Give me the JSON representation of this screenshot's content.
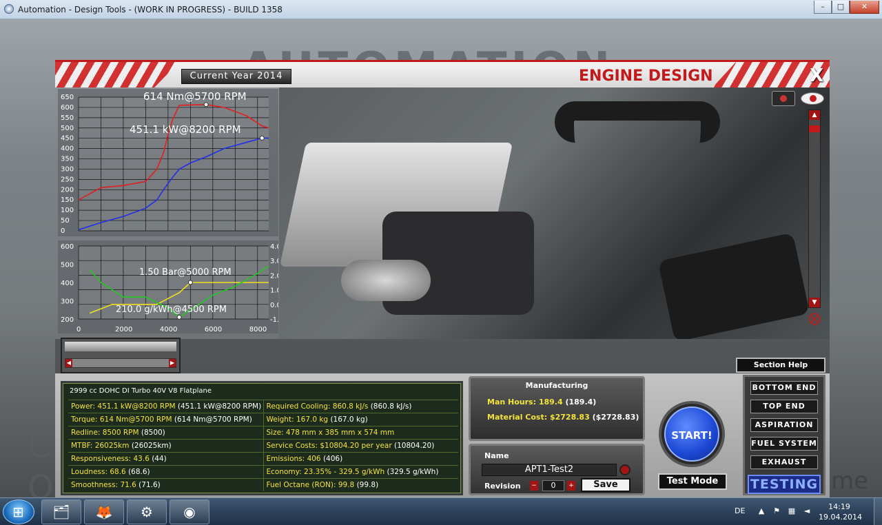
{
  "window": {
    "title": "Automation - Design Tools - (WORK IN PROGRESS) - BUILD 1358",
    "minimize": "–",
    "maximize": "□",
    "close": "✕"
  },
  "backdrop": {
    "left_text": "C\nO",
    "right_text": "me"
  },
  "header": {
    "year_label": "Current Year 2014",
    "title": "ENGINE DESIGN",
    "close_label": "X"
  },
  "graph_top": {
    "y_ticks": [
      "650",
      "600",
      "550",
      "500",
      "450",
      "400",
      "350",
      "300",
      "250",
      "200",
      "150",
      "100",
      "50",
      "0"
    ],
    "torque_label": "614 Nm@5700 RPM",
    "power_label": "451.1 kW@8200 RPM",
    "colors": {
      "torque": "#e02020",
      "power": "#1f2fe8"
    }
  },
  "graph_bottom": {
    "y_ticks_left": [
      "600",
      "500",
      "400",
      "300",
      "200"
    ],
    "y_ticks_right": [
      "4.0",
      "3.0",
      "2.0",
      "1.0",
      "0.0",
      "-1.0"
    ],
    "x_ticks": [
      "0",
      "2000",
      "4000",
      "6000",
      "8000"
    ],
    "boost_label": "1.50 Bar@5000 RPM",
    "bsfc_label": "210.0 g/kWh@4500 RPM",
    "colors": {
      "boost": "#f0e020",
      "bsfc": "#22c822"
    }
  },
  "chart_data": [
    {
      "type": "line",
      "title": "",
      "xlabel": "",
      "ylabel": "",
      "xlim": [
        0,
        8500
      ],
      "ylim": [
        0,
        650
      ],
      "series": [
        {
          "name": "",
          "x": [
            0,
            1000,
            2000,
            3000,
            3500,
            3800,
            4000,
            4200,
            4500,
            5000,
            5700,
            6500,
            7500,
            8200,
            8500
          ],
          "y": [
            150,
            210,
            220,
            240,
            300,
            380,
            470,
            540,
            610,
            612,
            614,
            600,
            560,
            510,
            500
          ]
        },
        {
          "name": "",
          "x": [
            0,
            1000,
            2000,
            3000,
            3500,
            3800,
            4200,
            4500,
            5000,
            5700,
            6500,
            7500,
            8200,
            8500
          ],
          "y": [
            5,
            40,
            70,
            110,
            150,
            200,
            260,
            300,
            330,
            360,
            400,
            430,
            451.1,
            451.1
          ]
        }
      ]
    },
    {
      "type": "line",
      "title": "",
      "xlabel": "",
      "ylabel": "",
      "xlim": [
        0,
        8500
      ],
      "ylim": [
        200,
        600
      ],
      "ylim_right": [
        -1.0,
        4.0
      ],
      "series": [
        {
          "name": "",
          "x": [
            500,
            1500,
            2500,
            3500,
            4000,
            4500,
            5000,
            6000,
            7000,
            8500
          ],
          "y": [
            -0.6,
            0.0,
            0.0,
            0.0,
            0.4,
            0.8,
            1.5,
            1.5,
            1.5,
            1.5
          ]
        },
        {
          "name": "",
          "x": [
            500,
            1000,
            2000,
            3000,
            4000,
            4500,
            5000,
            6000,
            7000,
            8000,
            8500
          ],
          "y": [
            470,
            400,
            320,
            320,
            260,
            210,
            250,
            330,
            380,
            450,
            490
          ]
        }
      ]
    }
  ],
  "stats": {
    "heading": "2999 cc DOHC DI Turbo 40V V8 Flatplane",
    "rows": [
      {
        "l_label": "Power: 451.1 kW@8200 RPM",
        "l_extra": " (451.1 kW@8200 RPM)",
        "r_label": "Required Cooling: 860.8 kJ/s",
        "r_extra": " (860.8 kJ/s)"
      },
      {
        "l_label": "Torque: 614 Nm@5700 RPM",
        "l_extra": " (614 Nm@5700 RPM)",
        "r_label": "Weight: 167.0 kg",
        "r_extra": " (167.0 kg)"
      },
      {
        "l_label": "Redline: 8500 RPM",
        "l_extra": " (8500)",
        "r_label": "Size: 478 mm x 385 mm x 574 mm",
        "r_extra": ""
      },
      {
        "l_label": "MTBF: 26025km",
        "l_extra": " (26025km)",
        "r_label": "Service Costs: $10804.20 per year",
        "r_extra": " (10804.20)"
      },
      {
        "l_label": "Responsiveness: 43.6",
        "l_extra": " (44)",
        "r_label": "Emissions: 406",
        "r_extra": " (406)"
      },
      {
        "l_label": "Loudness: 68.6",
        "l_extra": " (68.6)",
        "r_label": "Economy: 23.35% - 329.5 g/kWh",
        "r_extra": " (329.5 g/kWh)"
      },
      {
        "l_label": "Smoothness: 71.6",
        "l_extra": " (71.6)",
        "r_label": "Fuel Octane (RON): 99.8",
        "r_extra": " (99.8)"
      }
    ]
  },
  "manufacturing": {
    "title": "Manufacturing",
    "man_hours_label": "Man Hours: 189.4",
    "man_hours_extra": " (189.4)",
    "material_label": "Material Cost: $2728.83",
    "material_extra": " ($2728.83)"
  },
  "naming": {
    "name_label": "Name",
    "name_value": "APT1-Test2",
    "revision_label": "Revision",
    "revision_value": "0",
    "rev_minus": "−",
    "rev_plus": "+",
    "save_label": "Save"
  },
  "controls": {
    "section_help": "Section Help",
    "start_label": "START!",
    "test_mode_label": "Test Mode",
    "sections": [
      "BOTTOM END",
      "TOP END",
      "ASPIRATION",
      "FUEL SYSTEM",
      "EXHAUST"
    ],
    "testing_label": "TESTING"
  },
  "taskbar": {
    "apps": [
      "explorer-icon",
      "firefox-icon",
      "steam-icon",
      "automation-icon"
    ],
    "language": "DE",
    "time": "14:19",
    "date": "19.04.2014"
  }
}
